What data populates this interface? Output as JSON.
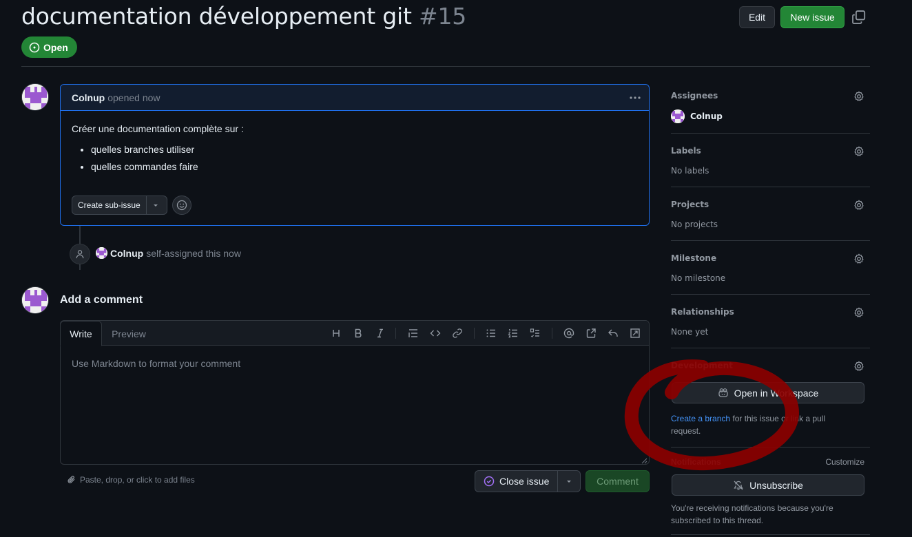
{
  "issue": {
    "title": "documentation développement git",
    "number": "#15",
    "state": "Open"
  },
  "header": {
    "edit_label": "Edit",
    "new_issue_label": "New issue"
  },
  "comment": {
    "author": "Colnup",
    "meta": "opened now",
    "body_intro": "Créer une documentation complète sur :",
    "body_items": [
      "quelles branches utiliser",
      "quelles commandes faire"
    ],
    "create_sub_issue_label": "Create sub-issue"
  },
  "event": {
    "actor": "Colnup",
    "action": "self-assigned this now"
  },
  "composer": {
    "title": "Add a comment",
    "tab_write": "Write",
    "tab_preview": "Preview",
    "placeholder": "Use Markdown to format your comment",
    "attach_label": "Paste, drop, or click to add files",
    "close_issue_label": "Close issue",
    "comment_label": "Comment"
  },
  "sidebar": {
    "assignees": {
      "label": "Assignees",
      "value": "Colnup"
    },
    "labels": {
      "label": "Labels",
      "value": "No labels"
    },
    "projects": {
      "label": "Projects",
      "value": "No projects"
    },
    "milestone": {
      "label": "Milestone",
      "value": "No milestone"
    },
    "relationships": {
      "label": "Relationships",
      "value": "None yet"
    },
    "development": {
      "label": "Development",
      "workspace_button": "Open in Workspace",
      "create_branch_link": "Create a branch",
      "text_middle": " for this issue or link a pull request."
    },
    "notifications": {
      "label": "Notifications",
      "customize": "Customize",
      "unsubscribe": "Unsubscribe",
      "reason": "You're receiving notifications because you're subscribed to this thread."
    }
  },
  "colors": {
    "accent_green": "#238636",
    "link_blue": "#4493f8",
    "annotation_red": "#8b0000"
  }
}
